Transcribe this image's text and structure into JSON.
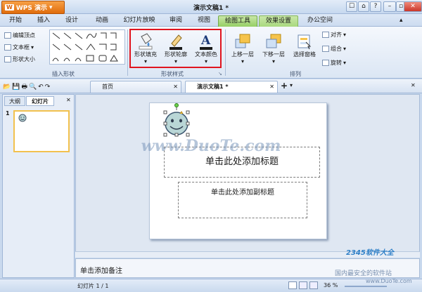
{
  "app": {
    "menu_label": "WPS 演示",
    "logo_letter": "W",
    "doc_title": "演示文稿1 *"
  },
  "tabs": [
    "开始",
    "插入",
    "设计",
    "动画",
    "幻灯片放映",
    "审阅",
    "视图",
    "绘图工具",
    "效果设置",
    "办公空间"
  ],
  "ribbon": {
    "insert_shape": {
      "cmd_edit_vertex": "编辑顶点",
      "cmd_textbox": "文本框",
      "cmd_shape_size": "形状大小",
      "label": "插入形状"
    },
    "shape_style": {
      "fill": "形状填充",
      "outline": "形状轮廓",
      "text_color": "文本颜色",
      "label": "形状样式"
    },
    "arrange": {
      "bring_forward": "上移一层",
      "send_backward": "下移一层",
      "selection_pane": "选择窗格",
      "align": "对齐",
      "group": "组合",
      "rotate": "旋转",
      "label": "排列"
    }
  },
  "doc_tabs": {
    "home": "首页",
    "current": "演示文稿1 *"
  },
  "left_panel": {
    "tab_outline": "大纲",
    "tab_slides": "幻灯片",
    "slide_number": "1"
  },
  "slide": {
    "title_placeholder": "单击此处添加标题",
    "subtitle_placeholder": "单击此处添加副标题"
  },
  "notes_placeholder": "单击添加备注",
  "status": {
    "slide_counter": "幻灯片 1 / 1",
    "zoom": "36 %"
  },
  "watermarks": {
    "center": "www.DuoTe.com",
    "corner_brand": "2345软件大全",
    "corner_slogan": "国内最安全的软件站",
    "corner_url": "www.DuoTe.com"
  },
  "colors": {
    "highlight_box": "#e0141e",
    "context_tab": "#95cf64",
    "wps_orange": "#e06c0c"
  }
}
